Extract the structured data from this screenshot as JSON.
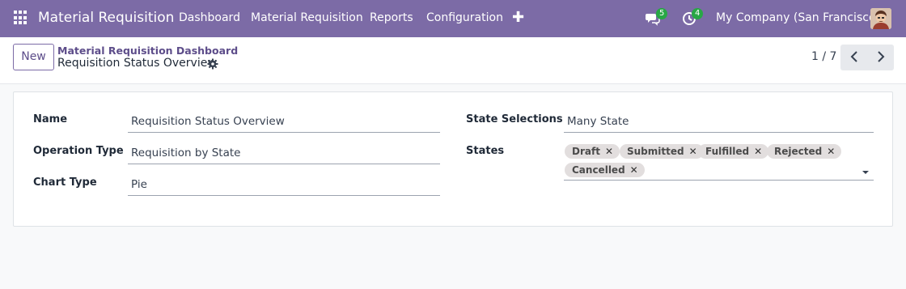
{
  "navbar": {
    "app_name": "Material Requisition",
    "menu": [
      "Dashboard",
      "Material Requisition",
      "Reports",
      "Configuration"
    ],
    "plus_icon": "plus-icon",
    "messages_count": "5",
    "activities_count": "4",
    "company": "My Company (San Francisco)",
    "accent_color": "#7c6ba6",
    "badge_color": "#28a745"
  },
  "control_panel": {
    "new_label": "New",
    "breadcrumb_parent": "Material Requisition Dashboard",
    "breadcrumb_current": "Requisition Status Overview",
    "pager_value": "1 / 7"
  },
  "form": {
    "left": [
      {
        "label": "Name",
        "value": "Requisition Status Overview"
      },
      {
        "label": "Operation Type",
        "value": "Requisition by State"
      },
      {
        "label": "Chart Type",
        "value": "Pie"
      }
    ],
    "state_selections_label": "State Selections",
    "state_selections_value": "Many State",
    "states_label": "States",
    "states_tags": [
      "Draft",
      "Submitted",
      "Fulfilled",
      "Rejected",
      "Cancelled"
    ],
    "tag_remove_glyph": "✕"
  }
}
